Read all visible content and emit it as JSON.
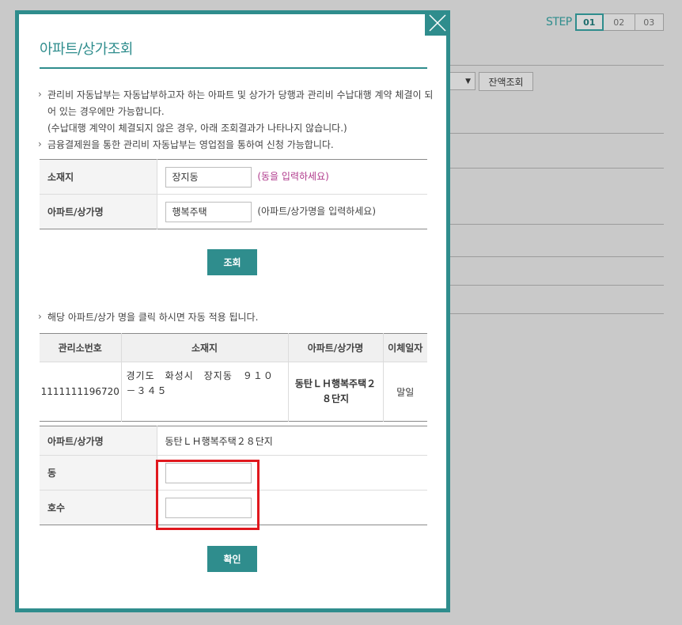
{
  "background": {
    "steps_label": "STEP",
    "steps": [
      "01",
      "02",
      "03"
    ],
    "select_arrow": "▼",
    "balance_button": "잔액조회"
  },
  "modal": {
    "title": "아파트/상가조회",
    "close_icon": "close-icon",
    "notes": [
      "관리비 자동납부는 자동납부하고자 하는 아파트 및 상가가 당행과 관리비 수납대행 계약 체결이 되어 있는 경우에만 가능합니다.",
      "(수납대행 계약이 체결되지 않은 경우, 아래 조회결과가 나타나지 않습니다.)",
      "금융결제원을 통한 관리비 자동납부는 영업점을 통하여 신청 가능합니다."
    ],
    "search_form": {
      "location_label": "소재지",
      "location_value": "장지동",
      "location_hint": "(동을 입력하세요)",
      "apt_label": "아파트/상가명",
      "apt_value": "행복주택",
      "apt_hint": "(아파트/상가명을 입력하세요)"
    },
    "search_button": "조회",
    "result_note": "해당 아파트/상가 명을 클릭 하시면 자동 적용 됩니다.",
    "result_table": {
      "headers": [
        "관리소번호",
        "소재지",
        "아파트/상가명",
        "이체일자"
      ],
      "rows": [
        {
          "office_no": "1111111196720",
          "address": "경기도　화성시　장지동　９１０－３４５",
          "apt_name": "동탄ＬＨ행복주택２８단지",
          "transfer_date": "말일"
        }
      ]
    },
    "detail_form": {
      "apt_label": "아파트/상가명",
      "apt_value": "동탄ＬＨ행복주택２８단지",
      "dong_label": "동",
      "dong_value": "",
      "ho_label": "호수",
      "ho_value": ""
    },
    "confirm_button": "확인",
    "colors": {
      "accent": "#2f8d8d",
      "highlight": "#e0181e",
      "hint": "#b03a8c"
    }
  }
}
